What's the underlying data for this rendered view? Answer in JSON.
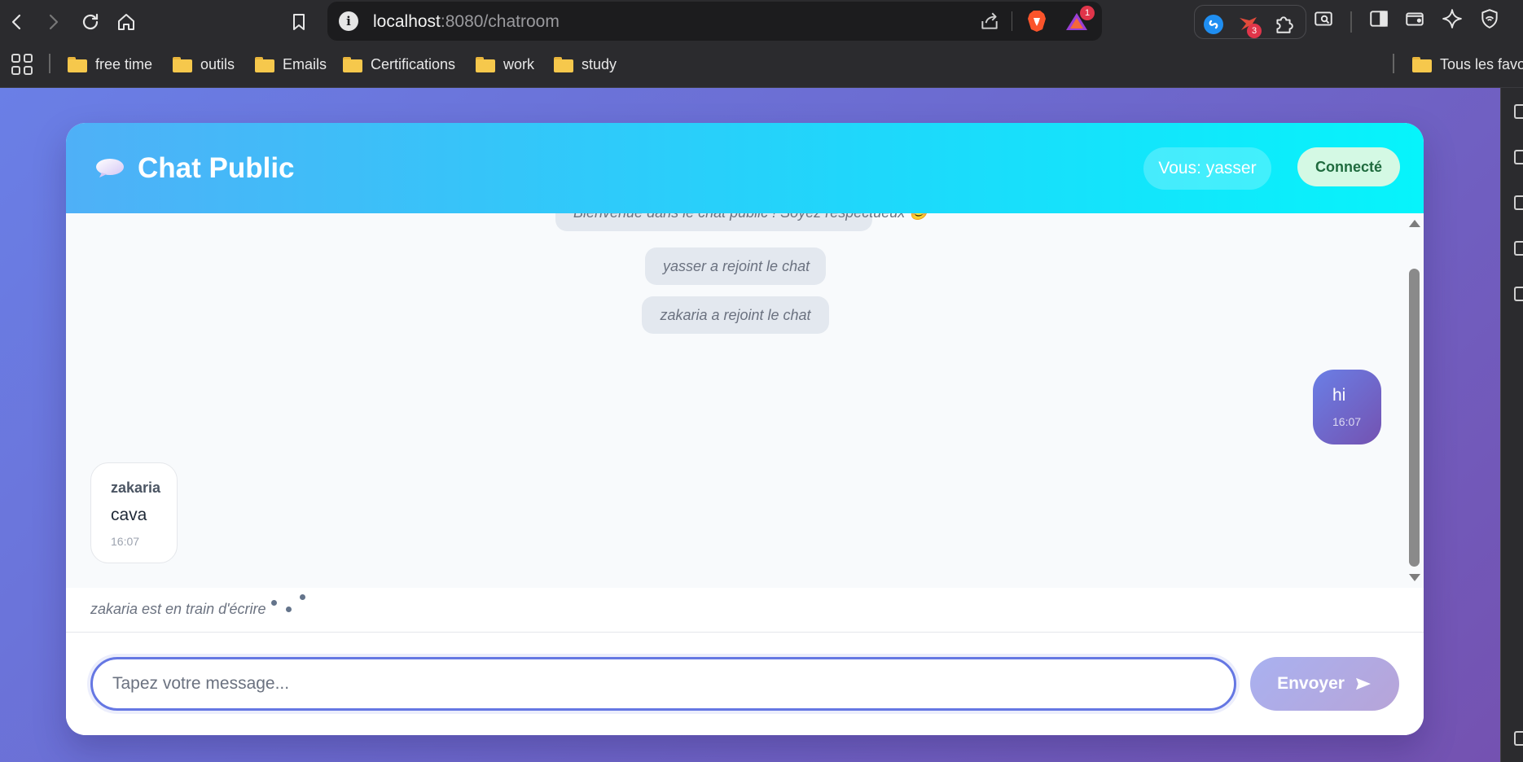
{
  "browser": {
    "url_host": "localhost",
    "url_path": ":8080/chatroom",
    "brave_rewards_badge": "1",
    "extension_badge": "3",
    "bookmarks": [
      "free time",
      "outils",
      "Emails",
      "Certifications",
      "work",
      "study"
    ],
    "all_bookmarks_label": "Tous les favori"
  },
  "chat": {
    "title": "Chat Public",
    "user_label": "Vous: yasser",
    "status": "Connecté",
    "system_messages": [
      "Bienvenue dans le chat public ! Soyez respectueux 😊",
      "yasser a rejoint le chat",
      "zakaria a rejoint le chat"
    ],
    "own_message": {
      "text": "hi",
      "time": "16:07"
    },
    "other_message": {
      "sender": "zakaria",
      "text": "cava",
      "time": "16:07"
    },
    "typing_indicator": "zakaria est en train d'écrire",
    "input_placeholder": "Tapez votre message...",
    "send_label": "Envoyer"
  },
  "colors": {
    "header_gradient_start": "#4fb0f7",
    "header_gradient_end": "#06f4fb",
    "page_gradient_start": "#6a7fe6",
    "page_gradient_end": "#7452b1",
    "status_bg": "#d4f9e4",
    "status_text": "#1f6b3e"
  }
}
